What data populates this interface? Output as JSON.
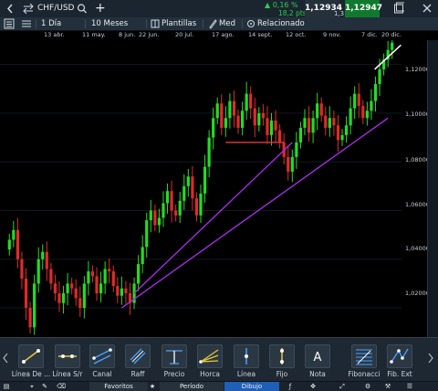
{
  "header": {
    "instrument": "CHF/USD",
    "add_label": "+",
    "change_pct": "0,16 %",
    "change_abs": "18,2 pts",
    "bid": "1,12934",
    "ask": "1,12947",
    "spread": "1,3"
  },
  "toolbar2": {
    "period": "1 Día",
    "range": "10 Meses",
    "templates": "Plantillas",
    "med": "Med",
    "related": "Relacionado"
  },
  "x_dates": [
    "13 abr.",
    "11 may.",
    "8 jun.",
    "22 jun.",
    "20 jul.",
    "17 ago.",
    "14 sept.",
    "12 oct.",
    "9 nov.",
    "7 dic.",
    "20 dic."
  ],
  "price_levels": [
    "1,120000",
    "1,100000",
    "1,080000",
    "1,060000",
    "1,040000",
    "1,020000"
  ],
  "chart_data": {
    "type": "candlestick",
    "title": "CHF/USD",
    "ylim": [
      1.008,
      1.13
    ],
    "x_ticks": [
      "13 abr.",
      "11 may.",
      "8 jun.",
      "22 jun.",
      "20 jul.",
      "17 ago.",
      "14 sept.",
      "12 oct.",
      "9 nov.",
      "7 dic.",
      "20 dic."
    ],
    "y_ticks": [
      1.12,
      1.1,
      1.08,
      1.06,
      1.04,
      1.02
    ],
    "close": [
      1.048,
      1.052,
      1.04,
      1.032,
      1.02,
      1.012,
      1.03,
      1.04,
      1.043,
      1.036,
      1.03,
      1.026,
      1.022,
      1.026,
      1.03,
      1.028,
      1.024,
      1.02,
      1.03,
      1.035,
      1.033,
      1.026,
      1.03,
      1.036,
      1.035,
      1.029,
      1.025,
      1.028,
      1.026,
      1.022,
      1.03,
      1.038,
      1.045,
      1.056,
      1.06,
      1.054,
      1.057,
      1.063,
      1.068,
      1.06,
      1.058,
      1.064,
      1.07,
      1.074,
      1.065,
      1.058,
      1.067,
      1.078,
      1.09,
      1.098,
      1.104,
      1.094,
      1.098,
      1.105,
      1.099,
      1.094,
      1.101,
      1.108,
      1.102,
      1.095,
      1.1,
      1.098,
      1.091,
      1.097,
      1.093,
      1.088,
      1.082,
      1.076,
      1.082,
      1.088,
      1.094,
      1.098,
      1.092,
      1.098,
      1.104,
      1.099,
      1.094,
      1.098,
      1.095,
      1.089,
      1.091,
      1.095,
      1.102,
      1.108,
      1.103,
      1.098,
      1.101,
      1.105,
      1.112,
      1.118,
      1.122,
      1.126,
      1.129
    ],
    "trendlines": [
      {
        "color": "#a02ce0",
        "from": [
          27,
          1.02
        ],
        "to": [
          91,
          1.098
        ]
      },
      {
        "color": "#a02ce0",
        "from": [
          30,
          1.026
        ],
        "to": [
          68,
          1.088
        ]
      }
    ],
    "hlines": [
      {
        "color": "#e03030",
        "y": 1.088,
        "from": 52,
        "to": 66
      }
    ],
    "marker_line": {
      "color": "#ffffff",
      "from": [
        90,
        1.118
      ],
      "to": [
        95,
        1.128
      ]
    }
  },
  "tools": [
    {
      "label": "Línea De ...",
      "icon": "line-segment-icon"
    },
    {
      "label": "Línea S/r",
      "icon": "support-resistance-icon"
    },
    {
      "label": "Canal",
      "icon": "channel-icon"
    },
    {
      "label": "Raff",
      "icon": "raff-icon"
    },
    {
      "label": "Precio",
      "icon": "price-line-icon"
    },
    {
      "label": "Horca",
      "icon": "pitchfork-icon"
    },
    {
      "label": "Línea",
      "icon": "vertical-line-icon"
    },
    {
      "label": "Fijo",
      "icon": "fixed-line-icon"
    },
    {
      "label": "Nota",
      "icon": "note-icon"
    },
    {
      "label": "Fibonacci",
      "icon": "fibonacci-icon"
    },
    {
      "label": "Fib. Ext",
      "icon": "fib-extension-icon"
    }
  ],
  "bottom_tabs": {
    "favorites": "Favoritos",
    "period": "Período",
    "drawing": "Dibujo"
  }
}
